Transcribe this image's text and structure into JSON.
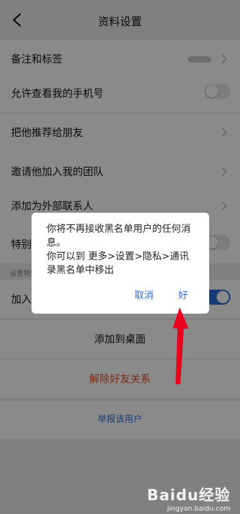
{
  "header": {
    "title": "资料设置",
    "back_icon": "chevron-left-icon"
  },
  "rows": [
    {
      "label": "备注和标签",
      "control": "chevron"
    },
    {
      "label": "允许查看我的手机号",
      "control": "toggle",
      "on": false
    },
    {
      "label": "把他推荐给朋友",
      "control": "chevron"
    },
    {
      "label": "邀请他加入我的团队",
      "control": "chevron"
    },
    {
      "label": "添加为外部联系人",
      "control": "chevron"
    },
    {
      "label": "特别关注",
      "control": "toggle",
      "on": false
    },
    {
      "label": "加入黑名单",
      "control": "toggle",
      "on": true
    }
  ],
  "tip": "设置特别关注后……",
  "actions": {
    "add_desktop": "添加到桌面",
    "remove_friend": "解除好友关系",
    "report": "举报该用户"
  },
  "dialog": {
    "line1": "你将不再接收黑名单用户的任何消息。",
    "line2": "你可以到 更多>设置>隐私>通讯录黑名单中移出",
    "cancel": "取消",
    "ok": "好"
  },
  "watermark": {
    "main": "Baidu经验",
    "sub": "jingyan.baidu.com"
  },
  "colors": {
    "accent": "#2f6de0",
    "danger": "#e0502c",
    "arrow": "#e8001c"
  }
}
